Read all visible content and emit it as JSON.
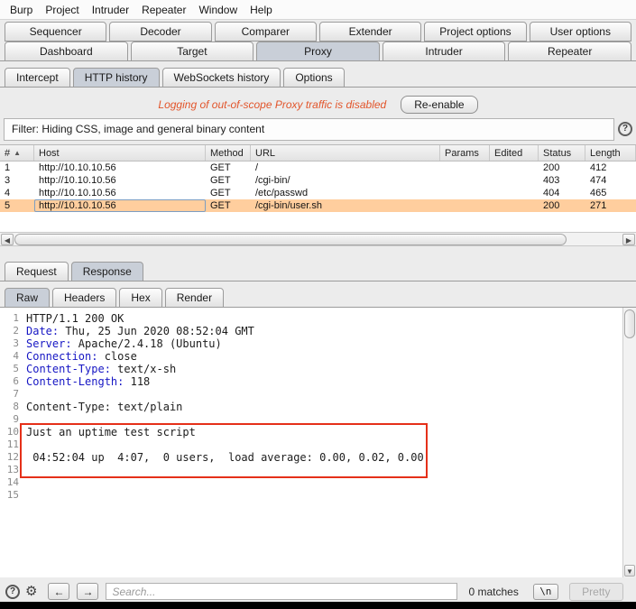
{
  "menubar": {
    "items": [
      "Burp",
      "Project",
      "Intruder",
      "Repeater",
      "Window",
      "Help"
    ]
  },
  "tabs": {
    "row1": [
      {
        "label": "Sequencer",
        "selected": false
      },
      {
        "label": "Decoder",
        "selected": false
      },
      {
        "label": "Comparer",
        "selected": false
      },
      {
        "label": "Extender",
        "selected": false
      },
      {
        "label": "Project options",
        "selected": false
      },
      {
        "label": "User options",
        "selected": false
      }
    ],
    "row2": [
      {
        "label": "Dashboard",
        "selected": false
      },
      {
        "label": "Target",
        "selected": false
      },
      {
        "label": "Proxy",
        "selected": true
      },
      {
        "label": "Intruder",
        "selected": false
      },
      {
        "label": "Repeater",
        "selected": false
      }
    ],
    "proxy_subtabs": [
      {
        "label": "Intercept",
        "selected": false
      },
      {
        "label": "HTTP history",
        "selected": true
      },
      {
        "label": "WebSockets history",
        "selected": false
      },
      {
        "label": "Options",
        "selected": false
      }
    ]
  },
  "notice": {
    "message": "Logging of out-of-scope Proxy traffic is disabled",
    "reenable_label": "Re-enable"
  },
  "filter": {
    "label": "Filter: Hiding CSS, image and general binary content"
  },
  "history_table": {
    "columns": [
      "#",
      "Host",
      "Method",
      "URL",
      "Params",
      "Edited",
      "Status",
      "Length"
    ],
    "sort_column": "#",
    "rows": [
      {
        "id": "1",
        "host": "http://10.10.10.56",
        "method": "GET",
        "url": "/",
        "params": "",
        "edited": "",
        "status": "200",
        "length": "412",
        "selected": false
      },
      {
        "id": "3",
        "host": "http://10.10.10.56",
        "method": "GET",
        "url": "/cgi-bin/",
        "params": "",
        "edited": "",
        "status": "403",
        "length": "474",
        "selected": false
      },
      {
        "id": "4",
        "host": "http://10.10.10.56",
        "method": "GET",
        "url": "/etc/passwd",
        "params": "",
        "edited": "",
        "status": "404",
        "length": "465",
        "selected": false
      },
      {
        "id": "5",
        "host": "http://10.10.10.56",
        "method": "GET",
        "url": "/cgi-bin/user.sh",
        "params": "",
        "edited": "",
        "status": "200",
        "length": "271",
        "selected": true
      }
    ]
  },
  "editor": {
    "tabs": [
      {
        "label": "Request",
        "selected": false
      },
      {
        "label": "Response",
        "selected": true
      }
    ],
    "view_tabs": [
      {
        "label": "Raw",
        "selected": true
      },
      {
        "label": "Headers",
        "selected": false
      },
      {
        "label": "Hex",
        "selected": false
      },
      {
        "label": "Render",
        "selected": false
      }
    ],
    "response_lines": [
      {
        "n": "1",
        "segments": [
          {
            "style": "plain",
            "text": "HTTP/1.1 200 OK"
          }
        ]
      },
      {
        "n": "2",
        "segments": [
          {
            "style": "header",
            "text": "Date:"
          },
          {
            "style": "plain",
            "text": " Thu, 25 Jun 2020 08:52:04 GMT"
          }
        ]
      },
      {
        "n": "3",
        "segments": [
          {
            "style": "header",
            "text": "Server:"
          },
          {
            "style": "plain",
            "text": " Apache/2.4.18 (Ubuntu)"
          }
        ]
      },
      {
        "n": "4",
        "segments": [
          {
            "style": "header",
            "text": "Connection:"
          },
          {
            "style": "plain",
            "text": " close"
          }
        ]
      },
      {
        "n": "5",
        "segments": [
          {
            "style": "header",
            "text": "Content-Type:"
          },
          {
            "style": "plain",
            "text": " text/x-sh"
          }
        ]
      },
      {
        "n": "6",
        "segments": [
          {
            "style": "header",
            "text": "Content-Length:"
          },
          {
            "style": "plain",
            "text": " 118"
          }
        ]
      },
      {
        "n": "7",
        "segments": []
      },
      {
        "n": "8",
        "segments": [
          {
            "style": "plain",
            "text": "Content-Type: text/plain"
          }
        ]
      },
      {
        "n": "9",
        "segments": []
      },
      {
        "n": "10",
        "segments": [
          {
            "style": "plain",
            "text": "Just an uptime test script"
          }
        ]
      },
      {
        "n": "11",
        "segments": []
      },
      {
        "n": "12",
        "segments": [
          {
            "style": "plain",
            "text": " 04:52:04 up  4:07,  0 users,  load average: 0.00, 0.02, 0.00"
          }
        ]
      },
      {
        "n": "13",
        "segments": []
      },
      {
        "n": "14",
        "segments": []
      },
      {
        "n": "15",
        "segments": []
      }
    ],
    "annotation": {
      "highlighted_lines": "10-13"
    }
  },
  "bottom_bar": {
    "search_placeholder": "Search...",
    "matches_text": "0 matches",
    "newline_button_label": "\\n",
    "pretty_button_label": "Pretty"
  },
  "icons": {
    "help": "?",
    "gear": "⚙",
    "prev": "←",
    "next": "→",
    "scroll_left": "◀",
    "scroll_right": "▶",
    "scroll_down": "▼",
    "sort_asc": "▲"
  },
  "colors": {
    "accent-notice": "#e2552b",
    "row-selected": "#ffce9e",
    "annotation-red": "#e53019",
    "syntax-header": "#1616c4",
    "tab-selected": "#c9cfd8"
  }
}
